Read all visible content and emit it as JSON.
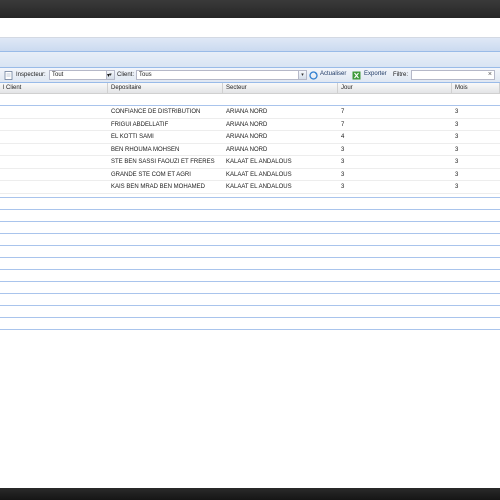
{
  "toolbar": {
    "inspecteur_label": "Inspecteur:",
    "inspecteur_value": "Tout",
    "client_label": "Client:",
    "client_value": "Tous",
    "actualiser_label": "Actualiser",
    "exporter_label": "Exporter",
    "filtre_label": "Filtre:",
    "filtre_value": "",
    "clear_glyph": "×",
    "trigger_glyph": "▾"
  },
  "grid": {
    "columns": [
      "l Client",
      "Depositaire",
      "Secteur",
      "Jour",
      "Mois"
    ],
    "rows": [
      {
        "client": "",
        "depositaire": "CONFIANCE DE DISTRIBUTION",
        "secteur": "ARIANA NORD",
        "jour": "7",
        "mois": "3"
      },
      {
        "client": "",
        "depositaire": "FRIGUI ABDELLATIF",
        "secteur": "ARIANA NORD",
        "jour": "7",
        "mois": "3"
      },
      {
        "client": "",
        "depositaire": "EL KOTTI SAMI",
        "secteur": "ARIANA NORD",
        "jour": "4",
        "mois": "3"
      },
      {
        "client": "",
        "depositaire": "BEN RHOUMA MOHSEN",
        "secteur": "ARIANA NORD",
        "jour": "3",
        "mois": "3"
      },
      {
        "client": "",
        "depositaire": "STE BEN SASSI FAOUZI ET FRERES",
        "secteur": "KALAAT EL ANDALOUS",
        "jour": "3",
        "mois": "3"
      },
      {
        "client": "",
        "depositaire": "GRANDE STE COM ET AGRI",
        "secteur": "KALAAT EL ANDALOUS",
        "jour": "3",
        "mois": "3"
      },
      {
        "client": "",
        "depositaire": "KAIS BEN MRAD BEN MOHAMED",
        "secteur": "KALAAT EL ANDALOUS",
        "jour": "3",
        "mois": "3"
      }
    ]
  },
  "colors": {
    "accent": "#99bbe8",
    "header_bg": "#dfe8f6",
    "row_line": "#a9c4ec"
  }
}
